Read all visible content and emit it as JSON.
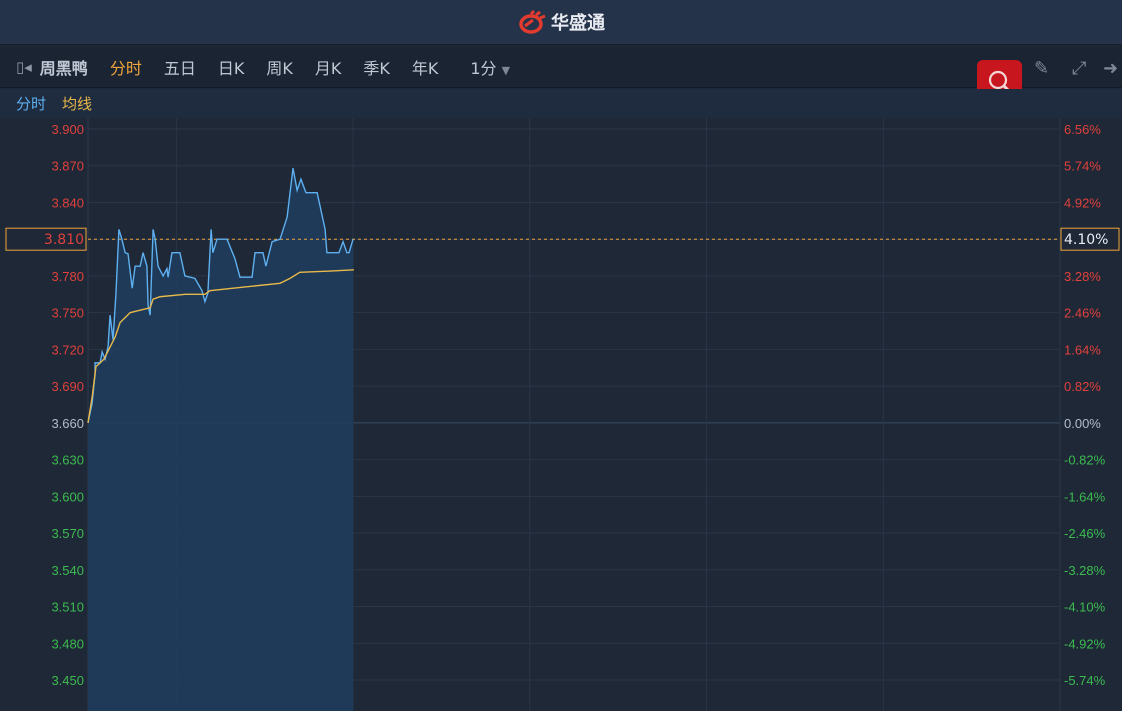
{
  "app": {
    "title": "华盛通"
  },
  "toolbar": {
    "stock_name": "周黑鸭",
    "tabs": [
      "分时",
      "五日",
      "日K",
      "周K",
      "月K",
      "季K",
      "年K"
    ],
    "active_tab": "分时",
    "interval": "1分"
  },
  "legend": {
    "price": "分时",
    "average": "均线"
  },
  "colors": {
    "up": "#e0413b",
    "down": "#3cbb4f",
    "flat": "#b4bcc8",
    "price_line": "#5eb0f0",
    "avg_line": "#e8b84a",
    "accent": "#f0a43a"
  },
  "chart_data": {
    "type": "line",
    "title": "周黑鸭 分时",
    "xlim": [
      0,
      330
    ],
    "ylim": [
      3.45,
      3.9
    ],
    "prev_close": 3.66,
    "current_price": "3.810",
    "current_change": "4.10%",
    "y_ticks": [
      "3.900",
      "3.870",
      "3.840",
      "3.810",
      "3.780",
      "3.750",
      "3.720",
      "3.690",
      "3.660",
      "3.630",
      "3.600",
      "3.570",
      "3.540",
      "3.510",
      "3.480",
      "3.450"
    ],
    "pct_ticks": [
      "6.56%",
      "5.74%",
      "4.92%",
      "4.10%",
      "3.28%",
      "2.46%",
      "1.64%",
      "0.82%",
      "0.00%",
      "-0.82%",
      "-1.64%",
      "-2.46%",
      "-3.28%",
      "-4.10%",
      "-4.92%",
      "-5.74%"
    ],
    "x_grid": [
      30,
      90,
      150,
      210,
      270,
      330
    ],
    "series": [
      {
        "name": "分时",
        "points": [
          [
            0,
            3.66
          ],
          [
            1.4,
            3.676
          ],
          [
            2.4,
            3.7
          ],
          [
            2.4,
            3.709
          ],
          [
            4.1,
            3.709
          ],
          [
            4.8,
            3.718
          ],
          [
            5.8,
            3.712
          ],
          [
            6.8,
            3.722
          ],
          [
            7.5,
            3.748
          ],
          [
            8.5,
            3.728
          ],
          [
            9.5,
            3.766
          ],
          [
            10.5,
            3.818
          ],
          [
            11.5,
            3.81
          ],
          [
            12.6,
            3.799
          ],
          [
            13.6,
            3.798
          ],
          [
            15,
            3.77
          ],
          [
            16,
            3.788
          ],
          [
            17.7,
            3.788
          ],
          [
            18.7,
            3.799
          ],
          [
            20.0,
            3.788
          ],
          [
            20.4,
            3.756
          ],
          [
            21.1,
            3.748
          ],
          [
            22.1,
            3.818
          ],
          [
            22.8,
            3.81
          ],
          [
            23.8,
            3.788
          ],
          [
            25.5,
            3.78
          ],
          [
            26.8,
            3.786
          ],
          [
            27.2,
            3.779
          ],
          [
            28.5,
            3.799
          ],
          [
            31.2,
            3.799
          ],
          [
            32.9,
            3.78
          ],
          [
            36.3,
            3.778
          ],
          [
            38.7,
            3.768
          ],
          [
            39.7,
            3.759
          ],
          [
            40.7,
            3.766
          ],
          [
            41.8,
            3.818
          ],
          [
            42.4,
            3.799
          ],
          [
            43.8,
            3.81
          ],
          [
            47.2,
            3.81
          ],
          [
            49.9,
            3.794
          ],
          [
            51.6,
            3.779
          ],
          [
            55.7,
            3.779
          ],
          [
            56.7,
            3.799
          ],
          [
            59.4,
            3.799
          ],
          [
            60.4,
            3.788
          ],
          [
            62.5,
            3.808
          ],
          [
            65.2,
            3.81
          ],
          [
            67.6,
            3.828
          ],
          [
            69.6,
            3.868
          ],
          [
            71,
            3.85
          ],
          [
            72.3,
            3.859
          ],
          [
            74,
            3.848
          ],
          [
            77.8,
            3.848
          ],
          [
            80.5,
            3.818
          ],
          [
            81.1,
            3.799
          ],
          [
            85.2,
            3.799
          ],
          [
            86.6,
            3.808
          ],
          [
            87.9,
            3.799
          ],
          [
            88.6,
            3.799
          ],
          [
            90,
            3.81
          ]
        ]
      },
      {
        "name": "均线",
        "points": [
          [
            0,
            3.66
          ],
          [
            1.4,
            3.681
          ],
          [
            2.7,
            3.706
          ],
          [
            4.1,
            3.709
          ],
          [
            5.4,
            3.712
          ],
          [
            9.2,
            3.73
          ],
          [
            10.9,
            3.742
          ],
          [
            14.3,
            3.75
          ],
          [
            17.7,
            3.752
          ],
          [
            21.1,
            3.754
          ],
          [
            22.1,
            3.761
          ],
          [
            24.4,
            3.763
          ],
          [
            33.0,
            3.765
          ],
          [
            39.7,
            3.765
          ],
          [
            41.4,
            3.768
          ],
          [
            53.3,
            3.771
          ],
          [
            65.2,
            3.774
          ],
          [
            68.6,
            3.778
          ],
          [
            71.9,
            3.783
          ],
          [
            82.2,
            3.784
          ],
          [
            90.3,
            3.785
          ]
        ]
      }
    ]
  }
}
